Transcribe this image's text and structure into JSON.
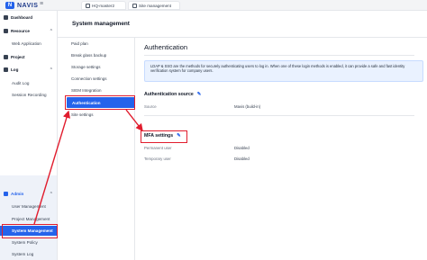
{
  "topbar": {
    "brand": "NAVIS",
    "tabs": [
      {
        "label": "HQ-master2"
      },
      {
        "label": "Site management"
      }
    ]
  },
  "sidebar": {
    "items": [
      {
        "label": "Dashboard",
        "icon": "dashboard-icon"
      },
      {
        "label": "Resource",
        "icon": "resource-icon"
      },
      {
        "label": "Web Application"
      },
      {
        "label": "Project",
        "icon": "project-icon"
      },
      {
        "label": "Log",
        "icon": "log-icon"
      },
      {
        "label": "Audit Log"
      },
      {
        "label": "Session Recording"
      }
    ],
    "admin": {
      "label": "Admin",
      "items": [
        {
          "label": "User Management"
        },
        {
          "label": "Project Management"
        },
        {
          "label": "System Management"
        },
        {
          "label": "System Policy"
        },
        {
          "label": "System Log"
        }
      ]
    }
  },
  "page": {
    "title": "System management"
  },
  "submenu": {
    "items": [
      {
        "label": "Paid plan"
      },
      {
        "label": "Break glass backup"
      },
      {
        "label": "Storage settings"
      },
      {
        "label": "Connection settings"
      },
      {
        "label": "SIEM Integration"
      },
      {
        "label": "Authentication"
      },
      {
        "label": "Site settings"
      }
    ]
  },
  "content": {
    "title": "Authentication",
    "info": "LDAP & SSO are the methods for securely authenticating users to log in. When one of these login methods is enabled, it can provide a safe and fast identity verification system for company users.",
    "auth_source": {
      "title": "Authentication source",
      "label": "Source",
      "value": "Mavis (build-in)"
    },
    "mfa": {
      "title": "MFA settings",
      "permanent_label": "Permanent user",
      "permanent_value": "Disabled",
      "temporary_label": "Temporary user",
      "temporary_value": "Disabled"
    }
  },
  "colors": {
    "accent": "#2563eb",
    "annotation": "#e11d2e"
  }
}
